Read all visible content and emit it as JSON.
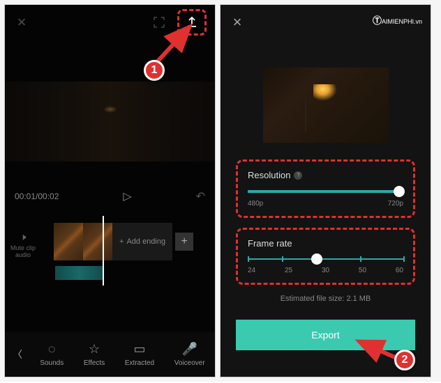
{
  "watermark": {
    "text": "AIMIENPHI",
    "suffix": ".vn"
  },
  "left": {
    "timecode": "00:01/00:02",
    "add_ending": "Add ending",
    "mute_label1": "Mute clip",
    "mute_label2": "audio",
    "nav": {
      "sounds": "Sounds",
      "effects": "Effects",
      "extracted": "Extracted",
      "voiceover": "Voiceover"
    }
  },
  "right": {
    "resolution": {
      "label": "Resolution",
      "min": "480p",
      "max": "720p",
      "value": "720p"
    },
    "framerate": {
      "label": "Frame rate",
      "ticks": [
        "24",
        "25",
        "30",
        "50",
        "60"
      ],
      "value": "30"
    },
    "estimate": "Estimated file size: 2.1 MB",
    "export_label": "Export"
  },
  "callouts": {
    "one": "1",
    "two": "2"
  }
}
